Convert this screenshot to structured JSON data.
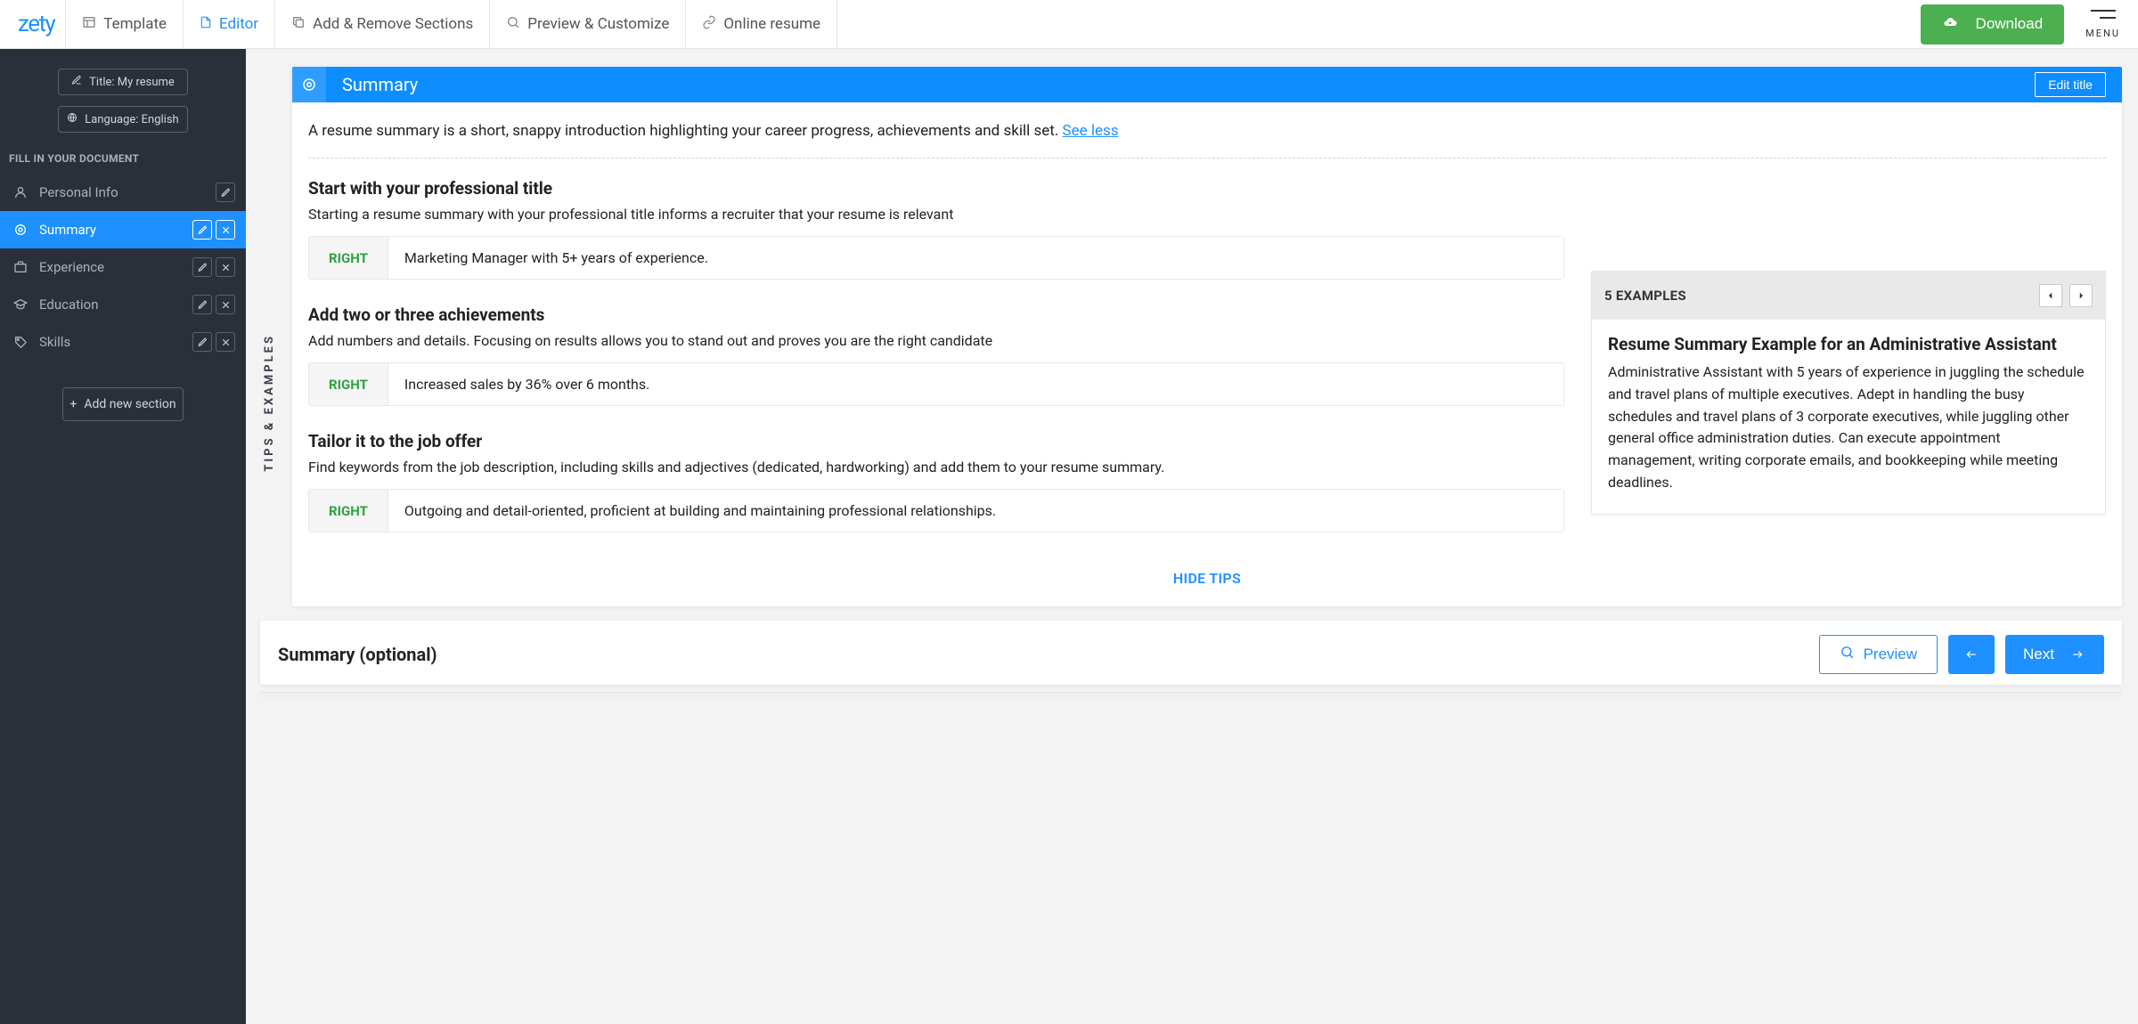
{
  "brand": "zety",
  "topnav": {
    "items": [
      {
        "label": "Template",
        "icon": "template-icon"
      },
      {
        "label": "Editor",
        "icon": "file-icon",
        "active": true
      },
      {
        "label": "Add & Remove Sections",
        "icon": "duplicate-icon"
      },
      {
        "label": "Preview & Customize",
        "icon": "magnify-icon"
      },
      {
        "label": "Online resume",
        "icon": "link-icon"
      }
    ],
    "download": "Download",
    "menu": "MENU"
  },
  "sidebar": {
    "titlePill": "Title: My resume",
    "langPill": "Language: English",
    "heading": "FILL IN YOUR DOCUMENT",
    "items": [
      {
        "label": "Personal Info",
        "icon": "person-icon",
        "actions": [
          "edit"
        ]
      },
      {
        "label": "Summary",
        "icon": "target-icon",
        "active": true,
        "actions": [
          "edit",
          "remove"
        ]
      },
      {
        "label": "Experience",
        "icon": "briefcase-icon",
        "actions": [
          "edit",
          "remove"
        ]
      },
      {
        "label": "Education",
        "icon": "cap-icon",
        "actions": [
          "edit",
          "remove"
        ]
      },
      {
        "label": "Skills",
        "icon": "tag-icon",
        "actions": [
          "edit",
          "remove"
        ]
      }
    ],
    "addSection": "Add new section"
  },
  "vtab": "TIPS & EXAMPLES",
  "header": {
    "title": "Summary",
    "editTitle": "Edit title"
  },
  "intro": {
    "text": "A resume summary is a short, snappy introduction highlighting your career progress, achievements and skill set. ",
    "link": "See less"
  },
  "tips": [
    {
      "title": "Start with your professional title",
      "desc": "Starting a resume summary with your professional title informs a recruiter that your resume is relevant",
      "rightLabel": "RIGHT",
      "rightText": "Marketing Manager with 5+ years of experience."
    },
    {
      "title": "Add two or three achievements",
      "desc": "Add numbers and details. Focusing on results allows you to stand out and proves you are the right candidate",
      "rightLabel": "RIGHT",
      "rightText": "Increased sales by 36% over 6 months."
    },
    {
      "title": "Tailor it to the job offer",
      "desc": "Find keywords from the job description, including skills and adjectives (dedicated, hardworking) and add them to your resume summary.",
      "rightLabel": "RIGHT",
      "rightText": "Outgoing and detail-oriented, proficient at building and maintaining professional relationships."
    }
  ],
  "examples": {
    "heading": "5 EXAMPLES",
    "title": "Resume Summary Example for an Administrative Assistant",
    "body": "Administrative Assistant with 5 years of experience in juggling the schedule and travel plans of multiple executives. Adept in handling the busy schedules and travel plans of 3 corporate executives, while juggling other general office administration duties. Can execute appointment management, writing corporate emails, and bookkeeping while meeting deadlines."
  },
  "hideTips": "HIDE TIPS",
  "summarySection": {
    "title": "Summary (optional)",
    "preview": "Preview",
    "next": "Next"
  }
}
